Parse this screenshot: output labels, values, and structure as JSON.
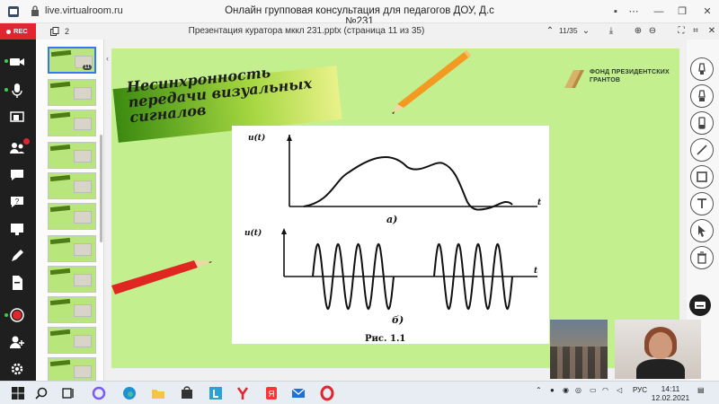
{
  "titlebar": {
    "url": "live.virtualroom.ru",
    "title": "Онлайн групповая консультация для педагогов ДОУ, Д.с №231"
  },
  "rail": {
    "rec_label": "REC"
  },
  "thumbs": {
    "count": "2",
    "active_index": 11,
    "active_label": "11"
  },
  "presentation": {
    "title": "Презентация куратора мккл 231.pptx (страница 11 из 35)",
    "page": "11/35"
  },
  "slide": {
    "heading": "Несинхронность передачи визуальных сигналов",
    "logo_text": "ФОНД ПРЕЗИДЕНТСКИХ ГРАНТОВ",
    "figure": {
      "axis_a": "u(t)",
      "axis_b": "u(t)",
      "t_a": "t",
      "t_b": "t",
      "label_a": "а)",
      "label_b": "б)",
      "caption": "Рис. 1.1"
    }
  },
  "taskbar": {
    "lang": "РУС",
    "time": "14:11",
    "date": "12.02.2021"
  },
  "colors": {
    "slide_bg": "#c3ef8f",
    "rec": "#e0262f",
    "rail": "#1f1f1f"
  }
}
